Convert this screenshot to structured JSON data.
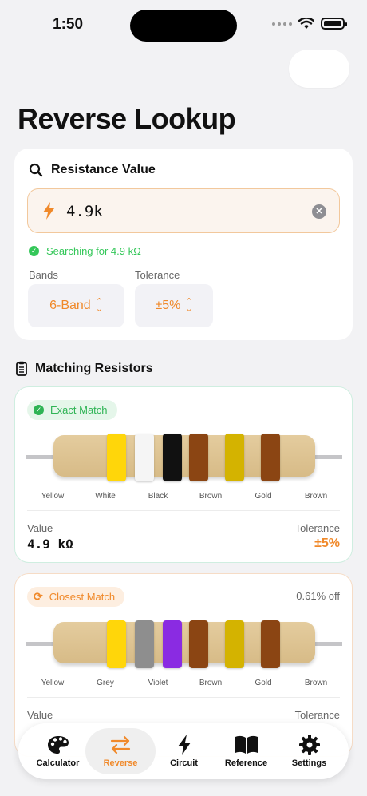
{
  "status": {
    "time": "1:50"
  },
  "page": {
    "title": "Reverse Lookup"
  },
  "resistance_card": {
    "heading": "Resistance Value",
    "input_value": "4.9k",
    "status": "Searching for 4.9 kΩ",
    "bands_label": "Bands",
    "bands_value": "6-Band",
    "tolerance_label": "Tolerance",
    "tolerance_value": "±5%"
  },
  "matches_section": {
    "title": "Matching Resistors"
  },
  "matches": [
    {
      "badge": "Exact Match",
      "kind": "exact",
      "bands": [
        {
          "name": "Yellow",
          "color": "#FFD60A"
        },
        {
          "name": "White",
          "color": "#F5F5F5"
        },
        {
          "name": "Black",
          "color": "#111111"
        },
        {
          "name": "Brown",
          "color": "#8B4513"
        },
        {
          "name": "Gold",
          "color": "#D4B300"
        },
        {
          "name": "Brown",
          "color": "#8B4513"
        }
      ],
      "value_label": "Value",
      "value": "4.9 kΩ",
      "tolerance_label": "Tolerance",
      "tolerance": "±5%"
    },
    {
      "badge": "Closest Match",
      "kind": "closest",
      "off": "0.61% off",
      "bands": [
        {
          "name": "Yellow",
          "color": "#FFD60A"
        },
        {
          "name": "Grey",
          "color": "#8E8E8E"
        },
        {
          "name": "Violet",
          "color": "#8A2BE2"
        },
        {
          "name": "Brown",
          "color": "#8B4513"
        },
        {
          "name": "Gold",
          "color": "#D4B300"
        },
        {
          "name": "Brown",
          "color": "#8B4513"
        }
      ],
      "value_label": "Value",
      "tolerance_label": "Tolerance"
    }
  ],
  "tabs": [
    {
      "label": "Calculator",
      "icon": "palette-icon"
    },
    {
      "label": "Reverse",
      "icon": "arrows-swap-icon",
      "active": true
    },
    {
      "label": "Circuit",
      "icon": "bolt-icon"
    },
    {
      "label": "Reference",
      "icon": "book-icon"
    },
    {
      "label": "Settings",
      "icon": "gear-icon"
    }
  ],
  "colors": {
    "accent": "#F0892A",
    "success": "#34C759"
  }
}
